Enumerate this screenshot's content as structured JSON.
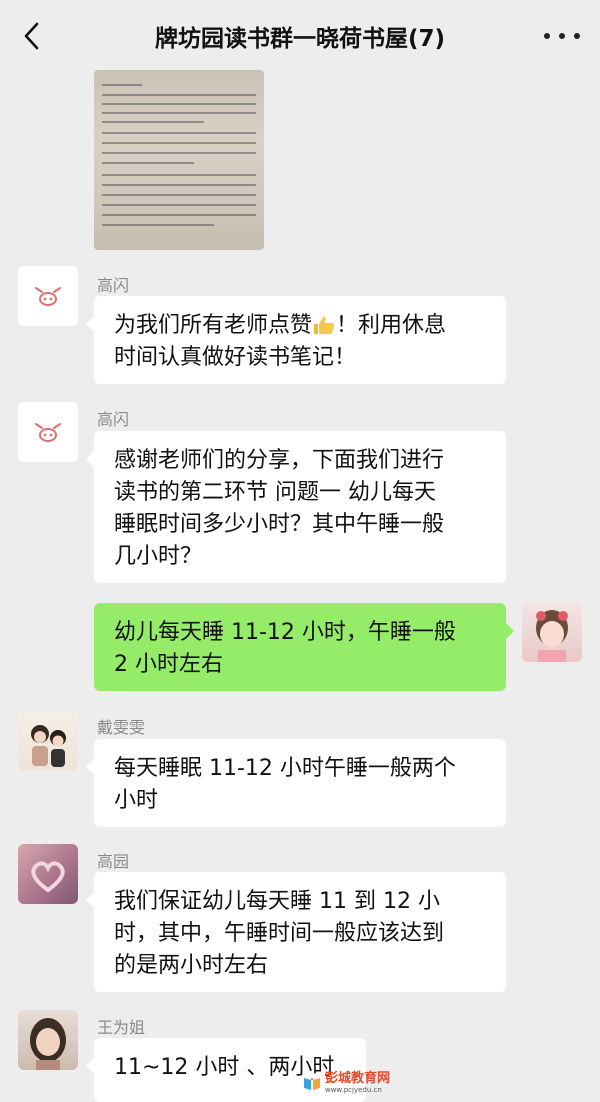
{
  "header": {
    "back_icon": "chevron-left-icon",
    "title": "牌坊园读书群一晓荷书屋(7)",
    "more_icon": "more-dots-icon"
  },
  "messages": [
    {
      "sender": "高闪",
      "avatar_icon": "pig-face-icon",
      "lines": [
        "为我们所有老师点赞",
        "时间认真做好读书笔记！"
      ],
      "line1_suffix": "！利用休息",
      "emoji": "thumbs-up-icon"
    },
    {
      "sender": "高闪",
      "avatar_icon": "pig-face-icon",
      "lines": [
        "感谢老师们的分享，下面我们进行",
        "读书的第二环节 问题一 幼儿每天",
        "睡眠时间多少小时？其中午睡一般",
        "几小时？"
      ]
    },
    {
      "sender": "self",
      "lines": [
        "幼儿每天睡 11-12 小时，午睡一般",
        "2 小时左右"
      ]
    },
    {
      "sender": "戴雯雯",
      "lines": [
        "每天睡眠 11-12 小时午睡一般两个",
        "小时"
      ]
    },
    {
      "sender": "高园",
      "lines": [
        "我们保证幼儿每天睡 11 到 12 小",
        "时，其中，午睡时间一般应该达到",
        "的是两小时左右"
      ]
    },
    {
      "sender": "王为姐",
      "lines": [
        "11~12 小时 、两小时"
      ]
    }
  ],
  "watermark": {
    "site_name": "彭城教育网",
    "site_url": "www.pcjyedu.cn"
  },
  "colors": {
    "background": "#ededed",
    "bubble_self": "#95ec69",
    "bubble_other": "#ffffff",
    "name_text": "#8a8a8a"
  }
}
